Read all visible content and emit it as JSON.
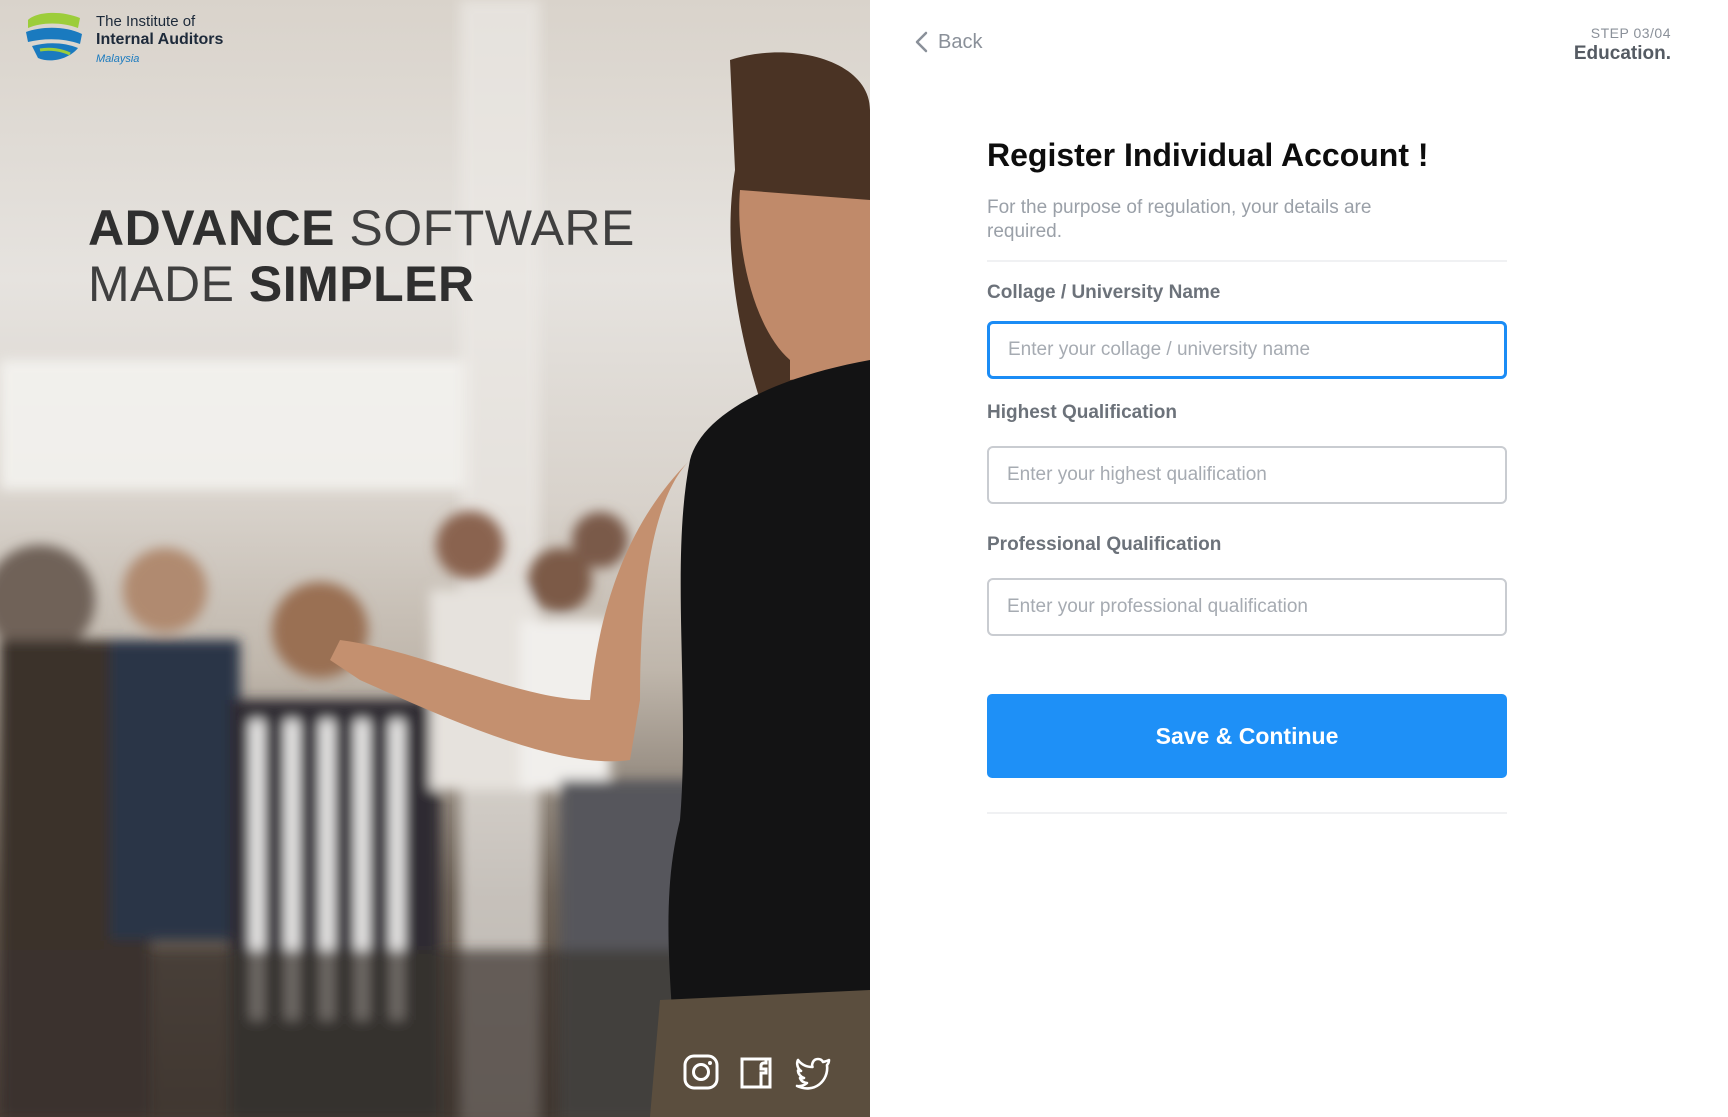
{
  "brand": {
    "line1": "The Institute of",
    "line2": "Internal Auditors",
    "line3": "Malaysia"
  },
  "hero": {
    "headline_line1_bold": "ADVANCE",
    "headline_line1_light": " SOFTWARE",
    "headline_line2_light": "MADE ",
    "headline_line2_bold": "SIMPLER"
  },
  "social": [
    "instagram-icon",
    "facebook-icon",
    "twitter-icon"
  ],
  "nav": {
    "back_label": "Back"
  },
  "step": {
    "label": "STEP 03/04",
    "name": "Education."
  },
  "form": {
    "title": "Register Individual Account !",
    "subtitle": "For the purpose of  regulation, your details are required.",
    "fields": [
      {
        "label": "Collage / University Name",
        "placeholder": "Enter your collage / university name",
        "value": ""
      },
      {
        "label": "Highest Qualification",
        "placeholder": "Enter your highest qualification",
        "value": ""
      },
      {
        "label": "Professional Qualification",
        "placeholder": "Enter your professional qualification",
        "value": ""
      }
    ],
    "submit_label": "Save & Continue"
  },
  "colors": {
    "accent": "#1e90f7",
    "focus_border": "#1b8cf5",
    "label": "#6c727a",
    "muted": "#9aa0a8"
  }
}
